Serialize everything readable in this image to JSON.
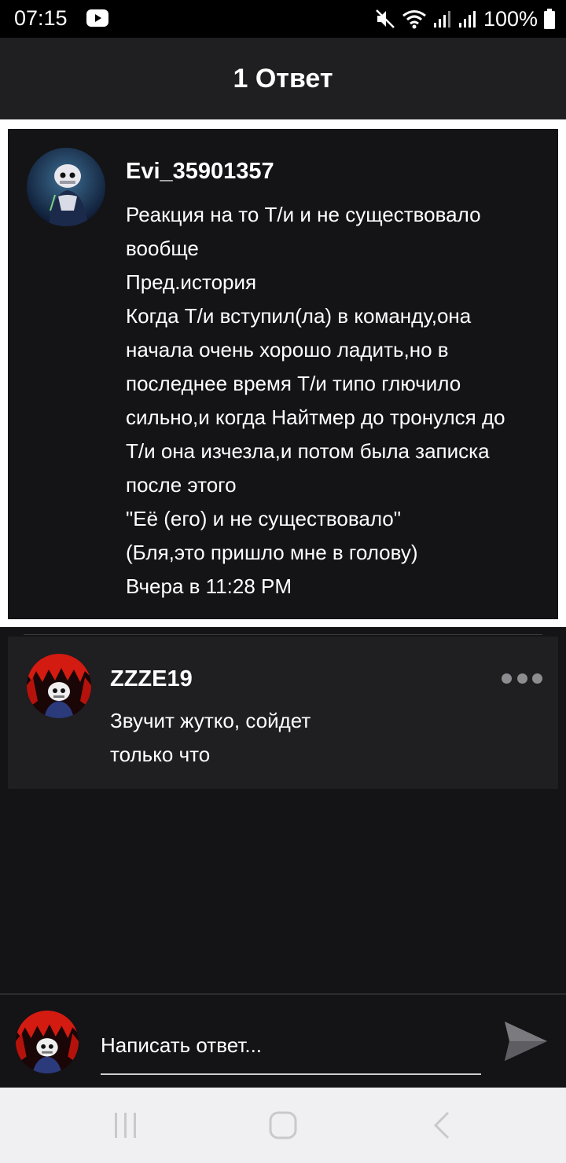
{
  "status_bar": {
    "time": "07:15",
    "battery": "100%",
    "icons": [
      "youtube-icon",
      "mute-icon",
      "wifi-icon",
      "signal-icon",
      "signal-icon",
      "battery-icon"
    ]
  },
  "header": {
    "title": "1 Ответ"
  },
  "parent_comment": {
    "username": "Evi_35901357",
    "lines": [
      "Реакция на то Т/и и не существовало",
      "вообще",
      "Пред.история",
      "Когда Т/и вступил(ла) в команду,она",
      "начала очень хорошо ладить,но в",
      "последнее время Т/и типо глючило",
      "сильно,и когда Найтмер до тронулся до",
      "Т/и она изчезла,и потом была записка",
      "после этого",
      "\"Её (его) и не существовало\"",
      "(Бля,это пришло мне в голову)",
      "Вчера в 11:28 PM"
    ]
  },
  "reply": {
    "username": "ZZZE19",
    "lines": [
      "Звучит жутко, сойдет",
      "только что"
    ],
    "more_icon": "more-icon"
  },
  "compose": {
    "placeholder": "Написать ответ...",
    "send_icon": "send-icon"
  },
  "nav_bar": {
    "icons": [
      "recent-apps-icon",
      "home-icon",
      "back-icon"
    ]
  },
  "colors": {
    "background": "#141316",
    "card": "#1f1e21",
    "text": "#ffffff",
    "muted": "#8d8c90"
  }
}
